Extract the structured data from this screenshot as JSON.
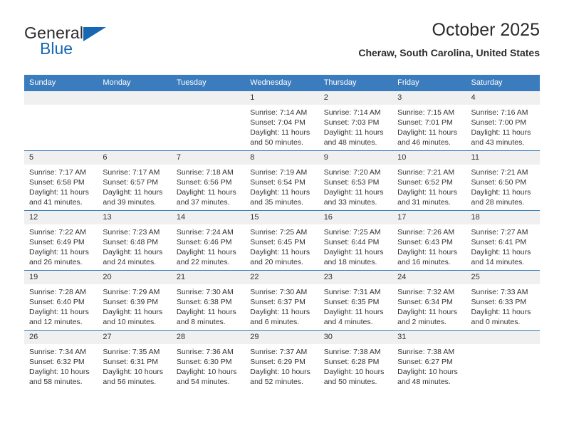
{
  "logo": {
    "primary_text": "General",
    "secondary_text": "Blue",
    "triangle_color": "#1668b3",
    "icon": "general-blue-logo"
  },
  "header": {
    "title": "October 2025",
    "subtitle": "Cheraw, South Carolina, United States"
  },
  "colors": {
    "header_row": "#3a7cbe",
    "day_band": "#f0f0f0",
    "brand_blue": "#1668b3",
    "text": "#333333"
  },
  "weekday_headers": [
    "Sunday",
    "Monday",
    "Tuesday",
    "Wednesday",
    "Thursday",
    "Friday",
    "Saturday"
  ],
  "labels": {
    "sunrise_prefix": "Sunrise:",
    "sunset_prefix": "Sunset:",
    "daylight_prefix": "Daylight:"
  },
  "weeks": [
    [
      {
        "day": "",
        "sunrise": "",
        "sunset": "",
        "daylight_line1": "",
        "daylight_line2": "",
        "empty": true
      },
      {
        "day": "",
        "sunrise": "",
        "sunset": "",
        "daylight_line1": "",
        "daylight_line2": "",
        "empty": true
      },
      {
        "day": "",
        "sunrise": "",
        "sunset": "",
        "daylight_line1": "",
        "daylight_line2": "",
        "empty": true
      },
      {
        "day": "1",
        "sunrise": "Sunrise: 7:14 AM",
        "sunset": "Sunset: 7:04 PM",
        "daylight_line1": "Daylight: 11 hours",
        "daylight_line2": "and 50 minutes.",
        "empty": false
      },
      {
        "day": "2",
        "sunrise": "Sunrise: 7:14 AM",
        "sunset": "Sunset: 7:03 PM",
        "daylight_line1": "Daylight: 11 hours",
        "daylight_line2": "and 48 minutes.",
        "empty": false
      },
      {
        "day": "3",
        "sunrise": "Sunrise: 7:15 AM",
        "sunset": "Sunset: 7:01 PM",
        "daylight_line1": "Daylight: 11 hours",
        "daylight_line2": "and 46 minutes.",
        "empty": false
      },
      {
        "day": "4",
        "sunrise": "Sunrise: 7:16 AM",
        "sunset": "Sunset: 7:00 PM",
        "daylight_line1": "Daylight: 11 hours",
        "daylight_line2": "and 43 minutes.",
        "empty": false
      }
    ],
    [
      {
        "day": "5",
        "sunrise": "Sunrise: 7:17 AM",
        "sunset": "Sunset: 6:58 PM",
        "daylight_line1": "Daylight: 11 hours",
        "daylight_line2": "and 41 minutes.",
        "empty": false
      },
      {
        "day": "6",
        "sunrise": "Sunrise: 7:17 AM",
        "sunset": "Sunset: 6:57 PM",
        "daylight_line1": "Daylight: 11 hours",
        "daylight_line2": "and 39 minutes.",
        "empty": false
      },
      {
        "day": "7",
        "sunrise": "Sunrise: 7:18 AM",
        "sunset": "Sunset: 6:56 PM",
        "daylight_line1": "Daylight: 11 hours",
        "daylight_line2": "and 37 minutes.",
        "empty": false
      },
      {
        "day": "8",
        "sunrise": "Sunrise: 7:19 AM",
        "sunset": "Sunset: 6:54 PM",
        "daylight_line1": "Daylight: 11 hours",
        "daylight_line2": "and 35 minutes.",
        "empty": false
      },
      {
        "day": "9",
        "sunrise": "Sunrise: 7:20 AM",
        "sunset": "Sunset: 6:53 PM",
        "daylight_line1": "Daylight: 11 hours",
        "daylight_line2": "and 33 minutes.",
        "empty": false
      },
      {
        "day": "10",
        "sunrise": "Sunrise: 7:21 AM",
        "sunset": "Sunset: 6:52 PM",
        "daylight_line1": "Daylight: 11 hours",
        "daylight_line2": "and 31 minutes.",
        "empty": false
      },
      {
        "day": "11",
        "sunrise": "Sunrise: 7:21 AM",
        "sunset": "Sunset: 6:50 PM",
        "daylight_line1": "Daylight: 11 hours",
        "daylight_line2": "and 28 minutes.",
        "empty": false
      }
    ],
    [
      {
        "day": "12",
        "sunrise": "Sunrise: 7:22 AM",
        "sunset": "Sunset: 6:49 PM",
        "daylight_line1": "Daylight: 11 hours",
        "daylight_line2": "and 26 minutes.",
        "empty": false
      },
      {
        "day": "13",
        "sunrise": "Sunrise: 7:23 AM",
        "sunset": "Sunset: 6:48 PM",
        "daylight_line1": "Daylight: 11 hours",
        "daylight_line2": "and 24 minutes.",
        "empty": false
      },
      {
        "day": "14",
        "sunrise": "Sunrise: 7:24 AM",
        "sunset": "Sunset: 6:46 PM",
        "daylight_line1": "Daylight: 11 hours",
        "daylight_line2": "and 22 minutes.",
        "empty": false
      },
      {
        "day": "15",
        "sunrise": "Sunrise: 7:25 AM",
        "sunset": "Sunset: 6:45 PM",
        "daylight_line1": "Daylight: 11 hours",
        "daylight_line2": "and 20 minutes.",
        "empty": false
      },
      {
        "day": "16",
        "sunrise": "Sunrise: 7:25 AM",
        "sunset": "Sunset: 6:44 PM",
        "daylight_line1": "Daylight: 11 hours",
        "daylight_line2": "and 18 minutes.",
        "empty": false
      },
      {
        "day": "17",
        "sunrise": "Sunrise: 7:26 AM",
        "sunset": "Sunset: 6:43 PM",
        "daylight_line1": "Daylight: 11 hours",
        "daylight_line2": "and 16 minutes.",
        "empty": false
      },
      {
        "day": "18",
        "sunrise": "Sunrise: 7:27 AM",
        "sunset": "Sunset: 6:41 PM",
        "daylight_line1": "Daylight: 11 hours",
        "daylight_line2": "and 14 minutes.",
        "empty": false
      }
    ],
    [
      {
        "day": "19",
        "sunrise": "Sunrise: 7:28 AM",
        "sunset": "Sunset: 6:40 PM",
        "daylight_line1": "Daylight: 11 hours",
        "daylight_line2": "and 12 minutes.",
        "empty": false
      },
      {
        "day": "20",
        "sunrise": "Sunrise: 7:29 AM",
        "sunset": "Sunset: 6:39 PM",
        "daylight_line1": "Daylight: 11 hours",
        "daylight_line2": "and 10 minutes.",
        "empty": false
      },
      {
        "day": "21",
        "sunrise": "Sunrise: 7:30 AM",
        "sunset": "Sunset: 6:38 PM",
        "daylight_line1": "Daylight: 11 hours",
        "daylight_line2": "and 8 minutes.",
        "empty": false
      },
      {
        "day": "22",
        "sunrise": "Sunrise: 7:30 AM",
        "sunset": "Sunset: 6:37 PM",
        "daylight_line1": "Daylight: 11 hours",
        "daylight_line2": "and 6 minutes.",
        "empty": false
      },
      {
        "day": "23",
        "sunrise": "Sunrise: 7:31 AM",
        "sunset": "Sunset: 6:35 PM",
        "daylight_line1": "Daylight: 11 hours",
        "daylight_line2": "and 4 minutes.",
        "empty": false
      },
      {
        "day": "24",
        "sunrise": "Sunrise: 7:32 AM",
        "sunset": "Sunset: 6:34 PM",
        "daylight_line1": "Daylight: 11 hours",
        "daylight_line2": "and 2 minutes.",
        "empty": false
      },
      {
        "day": "25",
        "sunrise": "Sunrise: 7:33 AM",
        "sunset": "Sunset: 6:33 PM",
        "daylight_line1": "Daylight: 11 hours",
        "daylight_line2": "and 0 minutes.",
        "empty": false
      }
    ],
    [
      {
        "day": "26",
        "sunrise": "Sunrise: 7:34 AM",
        "sunset": "Sunset: 6:32 PM",
        "daylight_line1": "Daylight: 10 hours",
        "daylight_line2": "and 58 minutes.",
        "empty": false
      },
      {
        "day": "27",
        "sunrise": "Sunrise: 7:35 AM",
        "sunset": "Sunset: 6:31 PM",
        "daylight_line1": "Daylight: 10 hours",
        "daylight_line2": "and 56 minutes.",
        "empty": false
      },
      {
        "day": "28",
        "sunrise": "Sunrise: 7:36 AM",
        "sunset": "Sunset: 6:30 PM",
        "daylight_line1": "Daylight: 10 hours",
        "daylight_line2": "and 54 minutes.",
        "empty": false
      },
      {
        "day": "29",
        "sunrise": "Sunrise: 7:37 AM",
        "sunset": "Sunset: 6:29 PM",
        "daylight_line1": "Daylight: 10 hours",
        "daylight_line2": "and 52 minutes.",
        "empty": false
      },
      {
        "day": "30",
        "sunrise": "Sunrise: 7:38 AM",
        "sunset": "Sunset: 6:28 PM",
        "daylight_line1": "Daylight: 10 hours",
        "daylight_line2": "and 50 minutes.",
        "empty": false
      },
      {
        "day": "31",
        "sunrise": "Sunrise: 7:38 AM",
        "sunset": "Sunset: 6:27 PM",
        "daylight_line1": "Daylight: 10 hours",
        "daylight_line2": "and 48 minutes.",
        "empty": false
      },
      {
        "day": "",
        "sunrise": "",
        "sunset": "",
        "daylight_line1": "",
        "daylight_line2": "",
        "empty": true
      }
    ]
  ]
}
